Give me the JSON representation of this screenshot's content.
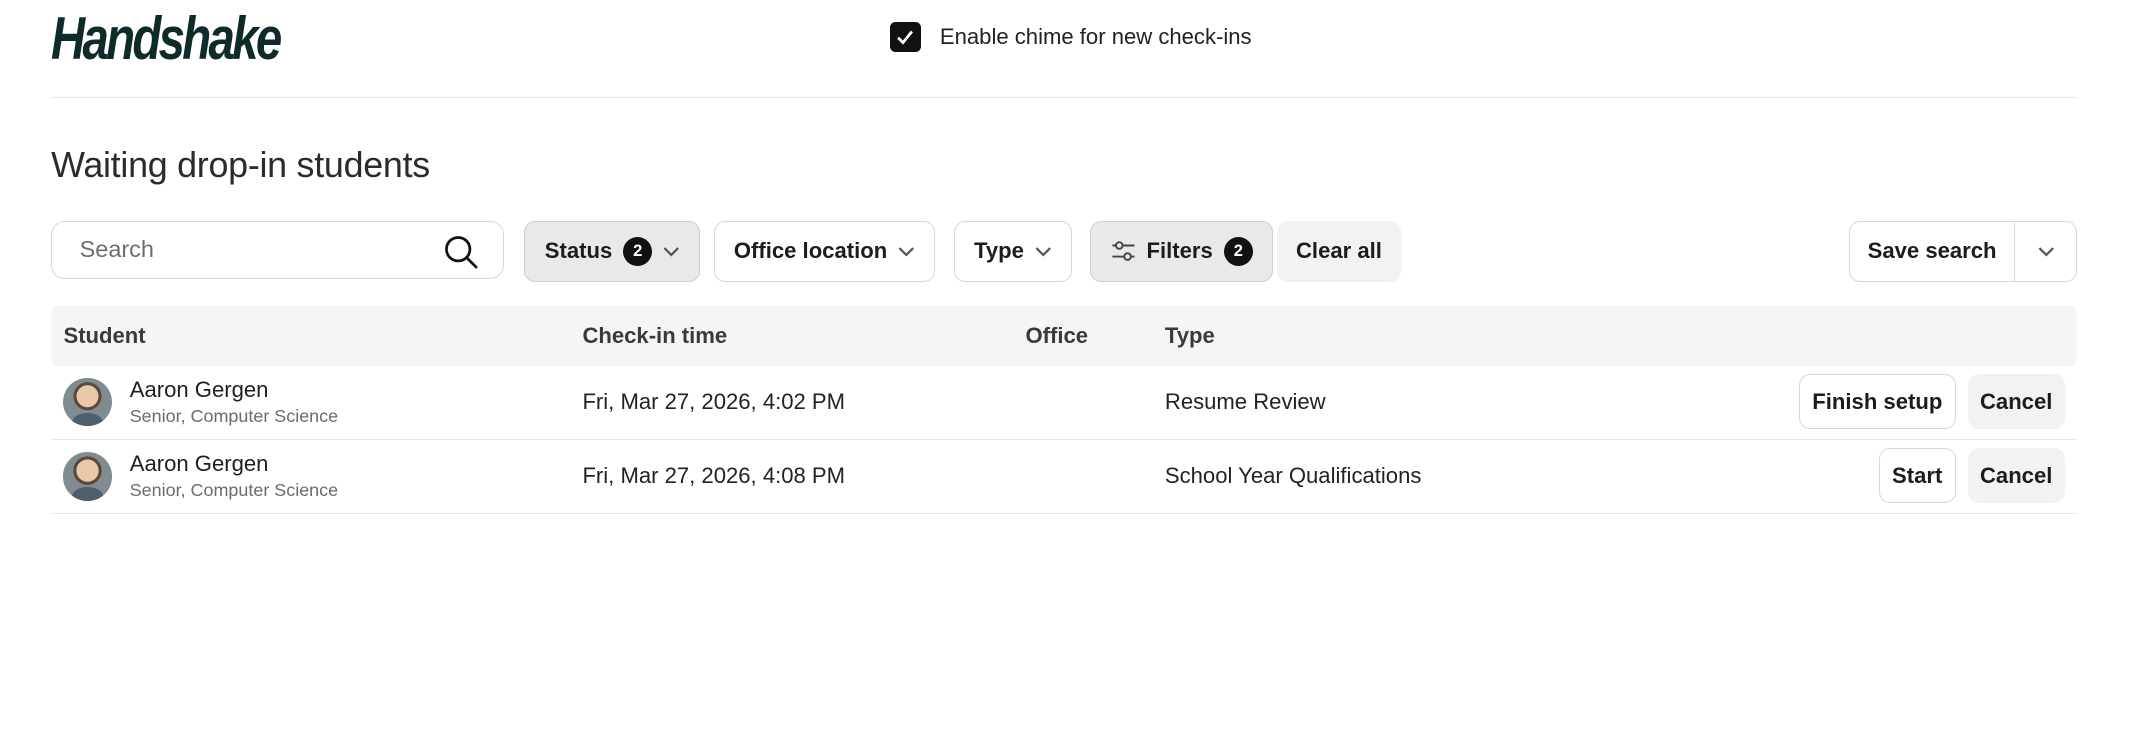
{
  "header": {
    "logo_text": "Handshake",
    "chime_label": "Enable chime for new check-ins",
    "chime_checked": true
  },
  "page_title": "Waiting drop-in students",
  "toolbar": {
    "search_placeholder": "Search",
    "status_label": "Status",
    "status_count": "2",
    "office_location_label": "Office location",
    "type_label": "Type",
    "filters_label": "Filters",
    "filters_count": "2",
    "clear_all_label": "Clear all",
    "save_search_label": "Save search"
  },
  "table": {
    "columns": {
      "student": "Student",
      "checkin": "Check-in time",
      "office": "Office",
      "type": "Type"
    },
    "rows": [
      {
        "name": "Aaron Gergen",
        "subtitle": "Senior, Computer Science",
        "checkin": "Fri, Mar 27, 2026, 4:02 PM",
        "office": "",
        "type": "Resume Review",
        "primary_action": "Finish setup",
        "secondary_action": "Cancel"
      },
      {
        "name": "Aaron Gergen",
        "subtitle": "Senior, Computer Science",
        "checkin": "Fri, Mar 27, 2026, 4:08 PM",
        "office": "",
        "type": "School Year Qualifications",
        "primary_action": "Start",
        "secondary_action": "Cancel"
      }
    ]
  },
  "icons": {
    "search": "search-icon",
    "chevron": "chevron-down-icon",
    "filters": "sliders-icon",
    "check": "check-icon"
  }
}
